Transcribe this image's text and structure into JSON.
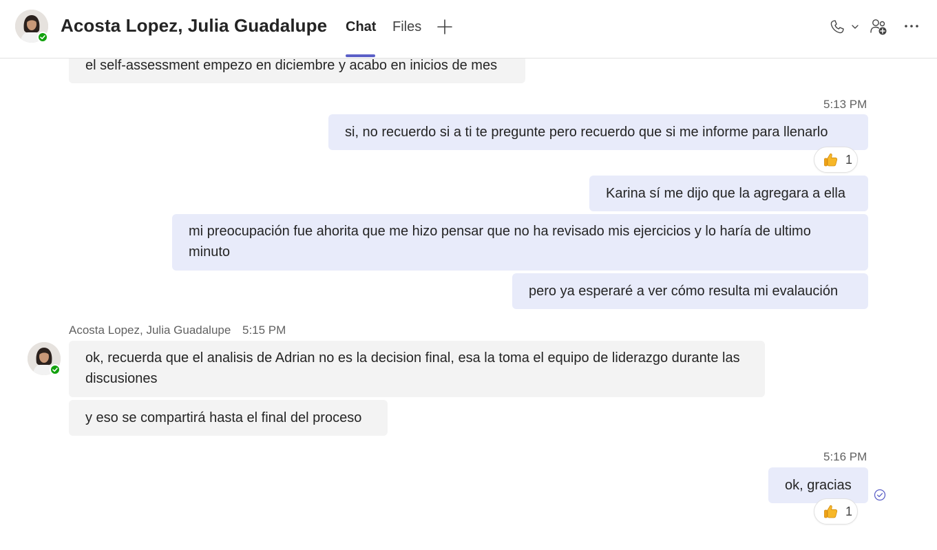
{
  "header": {
    "contact_name": "Acosta Lopez, Julia Guadalupe",
    "tabs": [
      {
        "label": "Chat",
        "active": true
      },
      {
        "label": "Files",
        "active": false
      }
    ],
    "add_tab_icon": "plus-icon",
    "actions": [
      "call-icon",
      "chevron-down-icon",
      "add-people-icon",
      "more-icon"
    ],
    "presence": "available",
    "accent_color": "#5b5fc7",
    "presence_color": "#13a10e"
  },
  "messages": [
    {
      "direction": "incoming",
      "text": "el self-assessment empezo en diciembre y acabo en inicios de mes"
    },
    {
      "direction": "outgoing",
      "time": "5:13 PM",
      "text": "si, no recuerdo si a ti te pregunte pero recuerdo que si me informe para llenarlo",
      "reaction": {
        "icon": "thumbs-up-icon",
        "count": "1"
      }
    },
    {
      "direction": "outgoing",
      "text": "Karina sí me dijo que la agregara a ella"
    },
    {
      "direction": "outgoing",
      "text": "mi preocupación fue ahorita que me hizo pensar que no ha revisado mis ejercicios y lo haría de ultimo minuto"
    },
    {
      "direction": "outgoing",
      "text": "pero ya esperaré a ver cómo resulta mi evalaución"
    },
    {
      "direction": "incoming",
      "sender": "Acosta Lopez, Julia Guadalupe",
      "time": "5:15 PM",
      "text": "ok, recuerda que el analisis de Adrian no es la decision final, esa la toma el equipo de liderazgo durante las discusiones"
    },
    {
      "direction": "incoming",
      "text": "y eso se compartirá hasta el final del proceso"
    },
    {
      "direction": "outgoing",
      "time": "5:16 PM",
      "text": "ok, gracias",
      "reaction": {
        "icon": "thumbs-up-icon",
        "count": "1"
      },
      "status": "seen-check-icon"
    }
  ],
  "colors": {
    "incoming_bubble": "#f3f3f3",
    "outgoing_bubble": "#e8ebfa"
  }
}
